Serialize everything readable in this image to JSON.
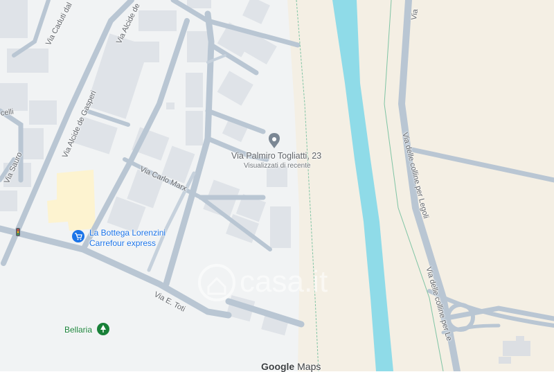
{
  "map": {
    "colors": {
      "land_urban": "#f1f3f4",
      "land_rural": "#f4efe4",
      "road": "#b9c6d3",
      "building": "#dfe3e8",
      "water": "#8fdbe8",
      "parcel": "#fdf3d0"
    },
    "pin": {
      "name": "Via Palmiro Togliatti, 23",
      "subtitle": "Visualizzati di recente",
      "icon": "place-pin-icon"
    },
    "streets": [
      {
        "id": "via-caduti",
        "name": "Via Caduti dal"
      },
      {
        "id": "via-alcide-de",
        "name": "Via Alcide de"
      },
      {
        "id": "via-alcide-de-gasperi",
        "name": "Via Alcide de Gasperi"
      },
      {
        "id": "celli",
        "name": "celli"
      },
      {
        "id": "via-sauro",
        "name": "Via Sauro"
      },
      {
        "id": "via-carlo-marx",
        "name": "Via Carlo Marx"
      },
      {
        "id": "via-e-toti",
        "name": "Via E. Toti"
      },
      {
        "id": "via-delle-colline-legoli-1",
        "name": "Via delle colline per Legoli"
      },
      {
        "id": "via-delle-colline-legoli-2",
        "name": "Via delle colline per Le"
      },
      {
        "id": "via-top-right",
        "name": "Via"
      }
    ],
    "pois": [
      {
        "id": "carrefour",
        "line1": "La Bottega Lorenzini",
        "line2": "Carrefour express",
        "icon": "shopping-cart-icon"
      },
      {
        "id": "bellaria",
        "name": "Bellaria",
        "icon": "park-icon"
      }
    ],
    "watermark": "casa.it",
    "attribution": {
      "google": "Google",
      "maps": "Maps"
    }
  }
}
